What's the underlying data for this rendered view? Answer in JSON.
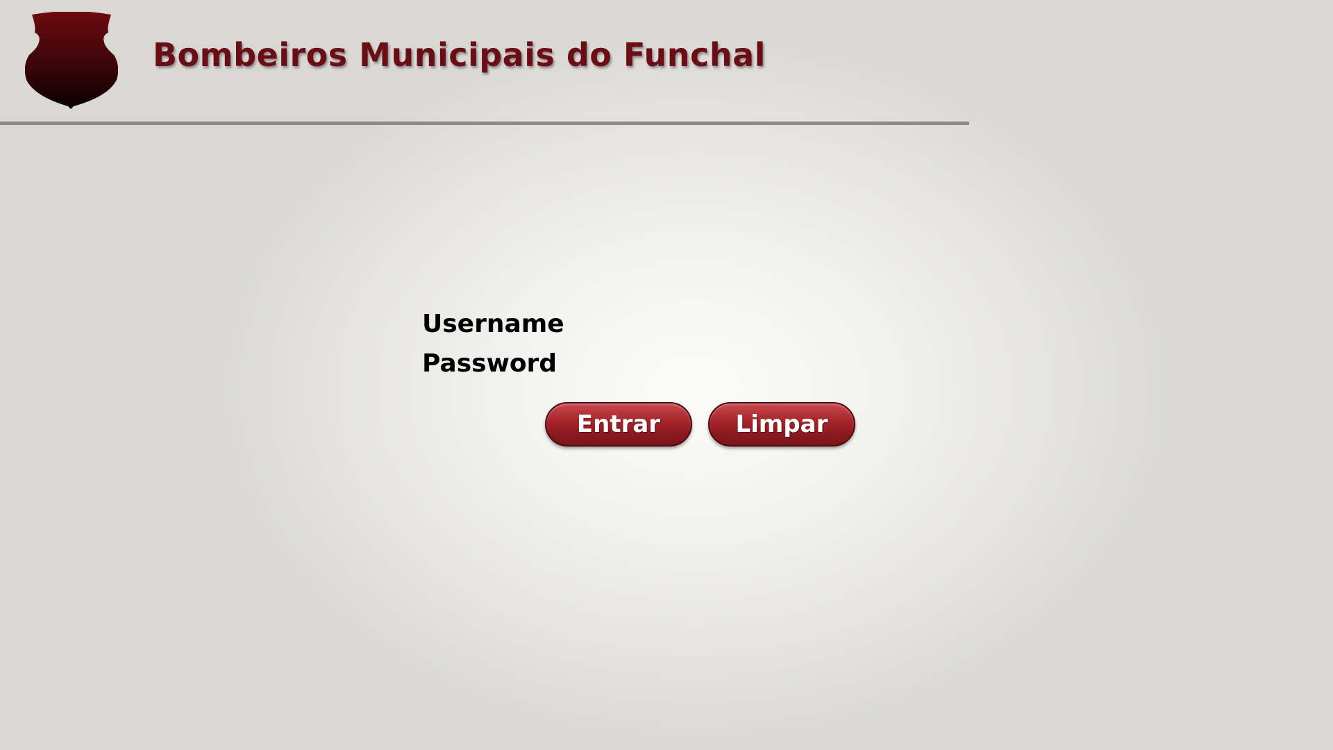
{
  "header": {
    "title": "Bombeiros Municipais do Funchal",
    "logo_icon": "shield-icon"
  },
  "login": {
    "username_label": "Username",
    "username_value": "",
    "password_label": "Password",
    "password_value": "",
    "submit_label": "Entrar",
    "clear_label": "Limpar"
  },
  "colors": {
    "brand_red": "#6b0d14",
    "button_red": "#a8262c",
    "rule_gray": "#8c8b8a"
  }
}
